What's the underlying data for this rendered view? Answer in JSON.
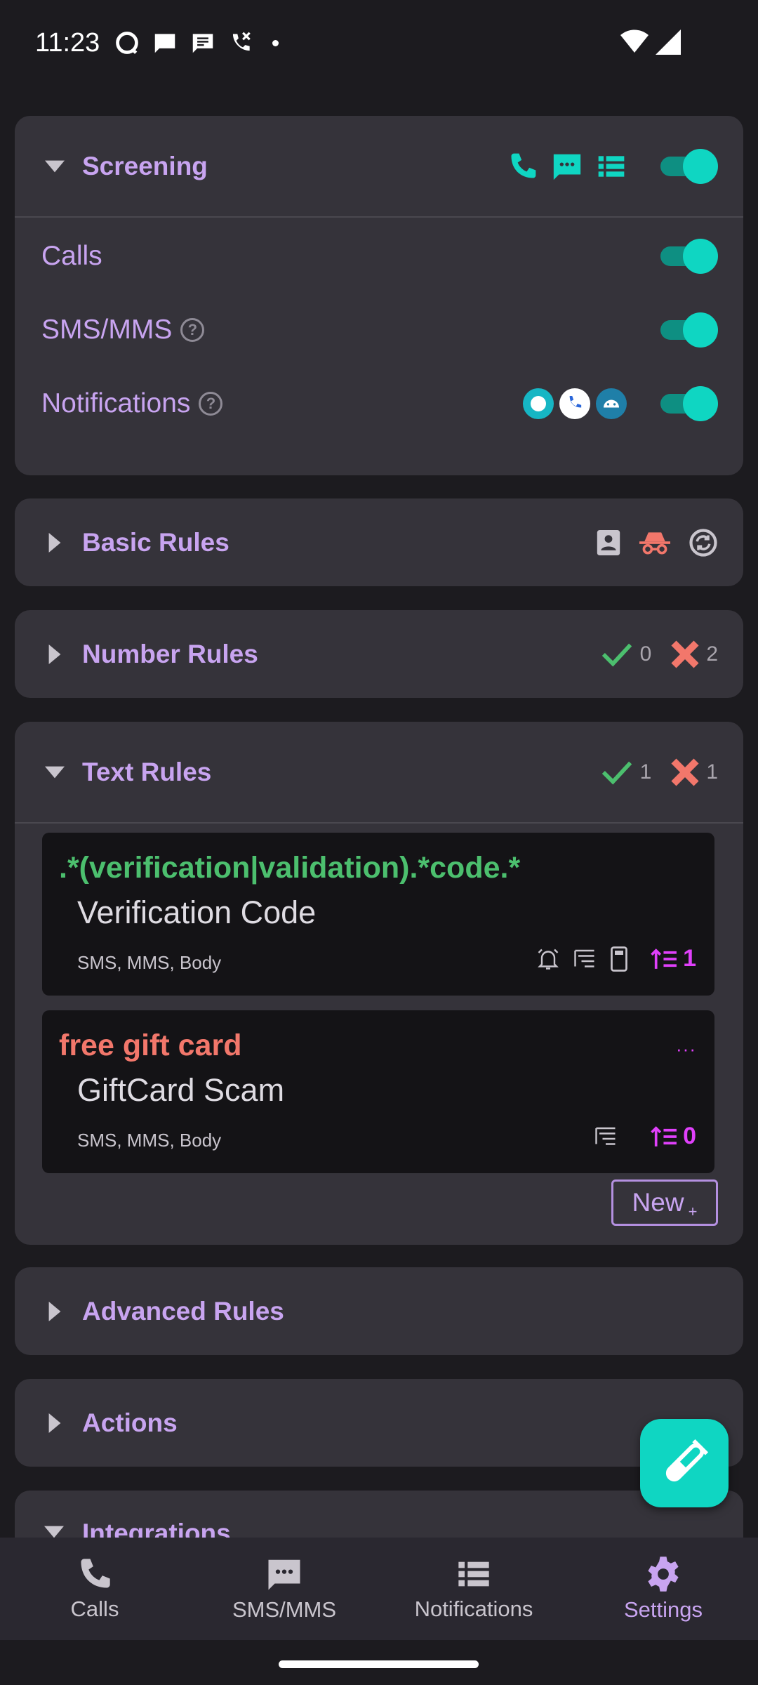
{
  "status": {
    "time": "11:23"
  },
  "screening": {
    "title": "Screening",
    "rows": {
      "calls": "Calls",
      "sms": "SMS/MMS",
      "notifications": "Notifications"
    }
  },
  "basic_rules": {
    "title": "Basic Rules"
  },
  "number_rules": {
    "title": "Number Rules",
    "allow_count": "0",
    "block_count": "2"
  },
  "text_rules": {
    "title": "Text Rules",
    "allow_count": "1",
    "block_count": "1",
    "rules": [
      {
        "pattern": ".*(verification|validation).*code.*",
        "description": "Verification Code",
        "meta": "SMS, MMS, Body",
        "priority": "1",
        "pattern_color": "#4cbf6e"
      },
      {
        "pattern": "free gift card",
        "description": "GiftCard Scam",
        "meta": "SMS, MMS, Body",
        "priority": "0",
        "pattern_color": "#f2776b",
        "more": "···"
      }
    ],
    "new_label": "New",
    "new_sup": "+"
  },
  "advanced_rules": {
    "title": "Advanced Rules"
  },
  "actions": {
    "title": "Actions"
  },
  "integrations": {
    "title": "Integrations"
  },
  "nav": {
    "calls": "Calls",
    "sms": "SMS/MMS",
    "notifications": "Notifications",
    "settings": "Settings"
  },
  "colors": {
    "accent": "#0fd6c2",
    "title": "#c8a4f0",
    "card": "#35333a",
    "allow": "#4cbf6e",
    "block": "#f2776b",
    "priority": "#e040fb"
  }
}
